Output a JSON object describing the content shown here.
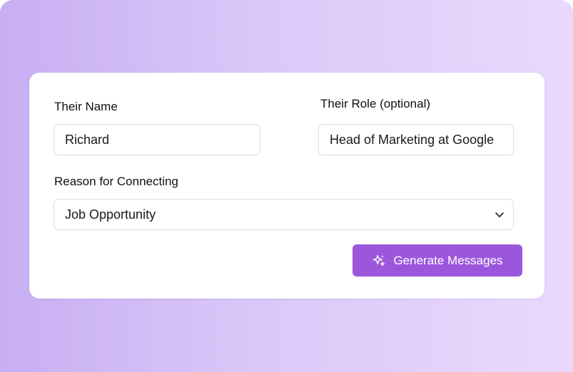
{
  "form": {
    "name_label": "Their Name",
    "name_value": "Richard",
    "role_label": "Their Role (optional)",
    "role_value": "Head of Marketing at Google",
    "reason_label": "Reason for Connecting",
    "reason_value": "Job Opportunity",
    "generate_label": "Generate Messages"
  },
  "icons": {
    "generate": "sparkles-icon",
    "select": "chevron-down-icon"
  },
  "colors": {
    "accent": "#9b57dc",
    "background_start": "#c8aef3",
    "background_end": "#ead9fd"
  }
}
